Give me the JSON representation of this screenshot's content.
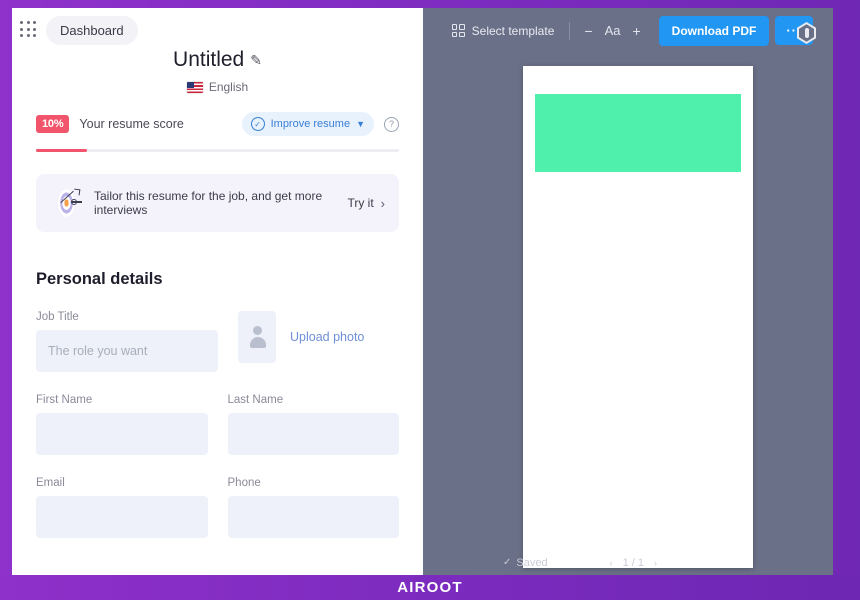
{
  "editor": {
    "grid_icon": "apps-grid-icon",
    "dashboard_label": "Dashboard",
    "document_title": "Untitled",
    "edit_icon": "pencil-icon",
    "language": "English",
    "flag_icon": "us-flag-icon",
    "score": {
      "badge": "10%",
      "label": "Your resume score",
      "progress_percent": 10,
      "improve_label": "Improve resume",
      "improve_icon": "check-circle-icon",
      "chevron_icon": "chevron-down-icon",
      "help_icon": "question-mark-icon",
      "help_label": "?"
    },
    "tailor_banner": {
      "icon": "target-arrow-icon",
      "text": "Tailor this resume for the job, and get more interviews",
      "cta": "Try it",
      "cta_icon": "chevron-right-icon"
    },
    "personal_details": {
      "section_title": "Personal details",
      "job_title_label": "Job Title",
      "job_title_placeholder": "The role you want",
      "job_title_value": "",
      "photo_icon": "avatar-placeholder-icon",
      "upload_photo_label": "Upload photo",
      "first_name_label": "First Name",
      "first_name_value": "",
      "last_name_label": "Last Name",
      "last_name_value": "",
      "email_label": "Email",
      "email_value": "",
      "phone_label": "Phone",
      "phone_value": ""
    }
  },
  "preview": {
    "toolbar": {
      "select_template_label": "Select template",
      "select_template_icon": "template-grid-icon",
      "zoom_out_label": "−",
      "font_size_label": "Aa",
      "zoom_in_label": "+",
      "download_label": "Download PDF",
      "more_label": "···",
      "shield_icon": "shield-badge-icon"
    },
    "page_header_color": "#4ef0ab",
    "status": {
      "saved_label": "Saved",
      "saved_icon": "check-icon",
      "page_indicator": "1 / 1",
      "prev_icon": "chevron-left-icon",
      "next_icon": "chevron-right-icon"
    }
  },
  "watermark": {
    "text": "AIROOT"
  }
}
